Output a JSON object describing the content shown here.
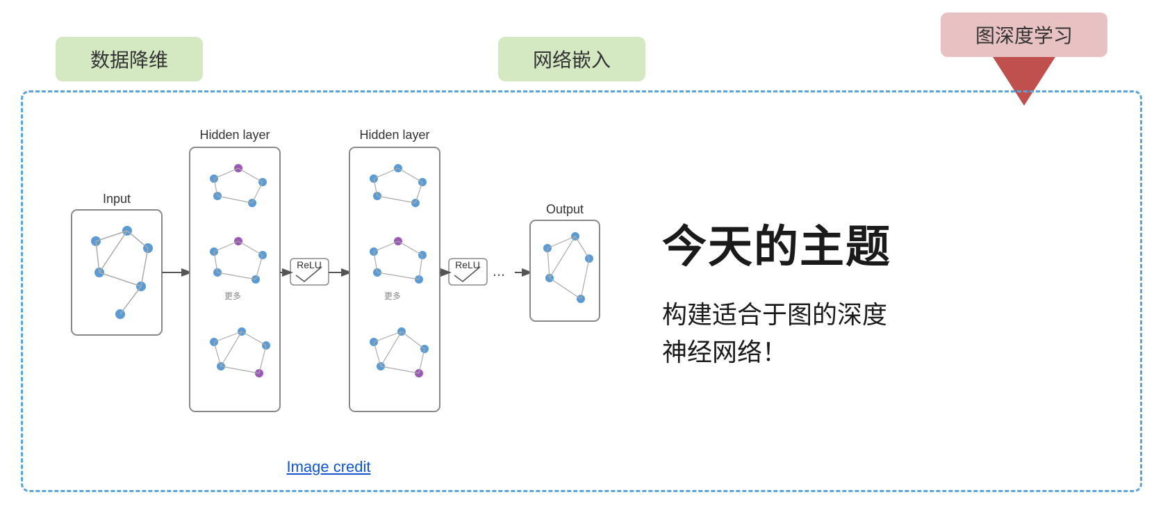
{
  "top_tags": [
    {
      "label": "数据降维",
      "style": "green"
    },
    {
      "label": "网络嵌入",
      "style": "green"
    },
    {
      "label": "图深度学习",
      "style": "red"
    }
  ],
  "nn_diagram": {
    "input_label": "Input",
    "hidden_layer_1_label": "Hidden layer",
    "hidden_layer_2_label": "Hidden layer",
    "output_label": "Output",
    "relu_label": "ReLU",
    "dots_label": "..."
  },
  "image_credit": {
    "label": "Image credit",
    "href": "#"
  },
  "right_panel": {
    "title": "今天的主题",
    "description": "构建适合于图的深度\n神经网络！"
  }
}
